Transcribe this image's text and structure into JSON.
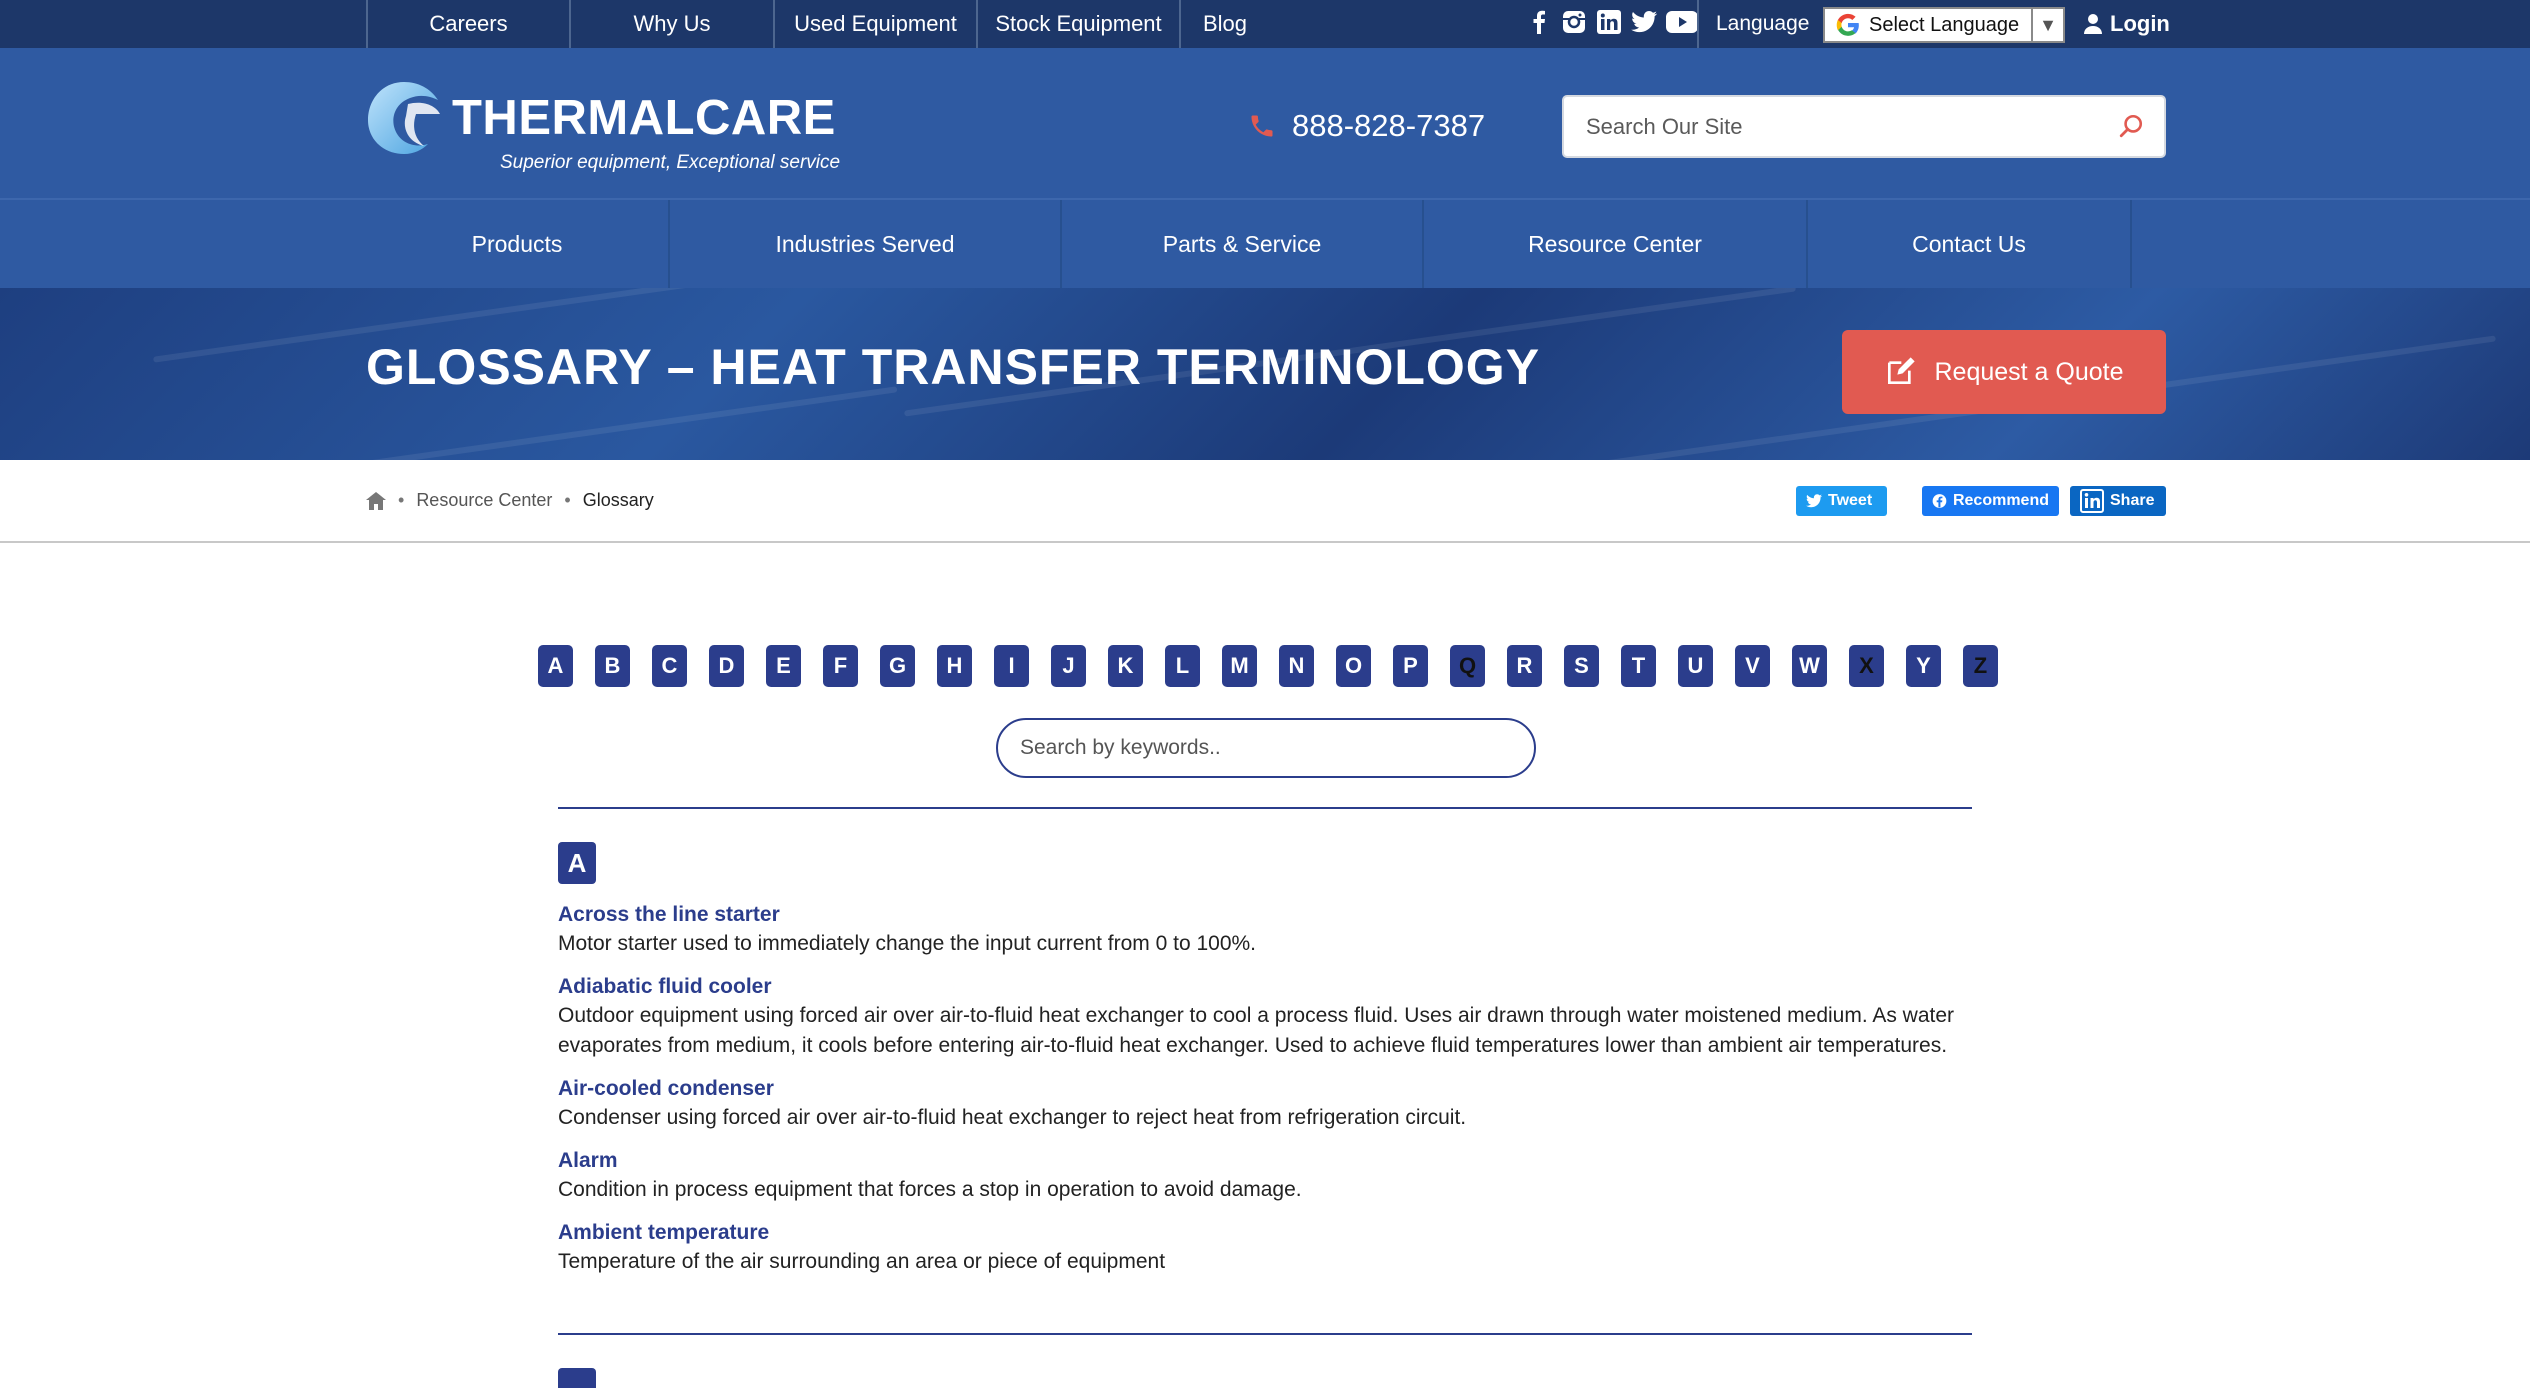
{
  "topbar": {
    "nav": [
      "Careers",
      "Why Us",
      "Used Equipment",
      "Stock Equipment",
      "Blog"
    ],
    "social_icons": [
      "facebook-icon",
      "instagram-icon",
      "linkedin-icon",
      "twitter-icon",
      "youtube-icon"
    ],
    "language_label": "Language",
    "language_select": "Select Language",
    "login": "Login"
  },
  "header": {
    "logo_text": "THERMALCARE",
    "logo_tagline": "Superior equipment, Exceptional service",
    "phone": "888-828-7387",
    "search_placeholder": "Search Our Site"
  },
  "mainnav": [
    "Products",
    "Industries Served",
    "Parts & Service",
    "Resource Center",
    "Contact Us"
  ],
  "banner": {
    "title": "GLOSSARY – HEAT TRANSFER TERMINOLOGY",
    "quote_button": "Request a Quote"
  },
  "breadcrumb": {
    "items": [
      "Resource Center",
      "Glossary"
    ]
  },
  "share": {
    "tweet": "Tweet",
    "facebook": "Recommend",
    "linkedin": "Share"
  },
  "alphabet": [
    "A",
    "B",
    "C",
    "D",
    "E",
    "F",
    "G",
    "H",
    "I",
    "J",
    "K",
    "L",
    "M",
    "N",
    "O",
    "P",
    "Q",
    "R",
    "S",
    "T",
    "U",
    "V",
    "W",
    "X",
    "Y",
    "Z"
  ],
  "alphabet_dim": [
    "Q",
    "X",
    "Z"
  ],
  "keyword_search_placeholder": "Search by keywords..",
  "glossary": {
    "section_letter": "A",
    "terms": [
      {
        "term": "Across the line starter",
        "definition": "Motor starter used to immediately change the input current from 0 to 100%."
      },
      {
        "term": "Adiabatic fluid cooler",
        "definition": "Outdoor equipment using forced air over air-to-fluid heat exchanger to cool a process fluid. Uses air drawn through water moistened medium. As water evaporates from medium, it cools before entering air-to-fluid heat exchanger. Used to achieve fluid temperatures lower than ambient air temperatures."
      },
      {
        "term": "Air-cooled condenser",
        "definition": "Condenser using forced air over air-to-fluid heat exchanger to reject heat from refrigeration circuit."
      },
      {
        "term": "Alarm",
        "definition": "Condition in process equipment that forces a stop in operation to avoid damage."
      },
      {
        "term": "Ambient temperature",
        "definition": "Temperature of the air surrounding an area or piece of equipment"
      }
    ]
  },
  "colors": {
    "topbar": "#1d3769",
    "header": "#2f5aa2",
    "accent_navy": "#2b3d8c",
    "quote_red": "#e15a51",
    "phone_icon": "#e15a51"
  }
}
